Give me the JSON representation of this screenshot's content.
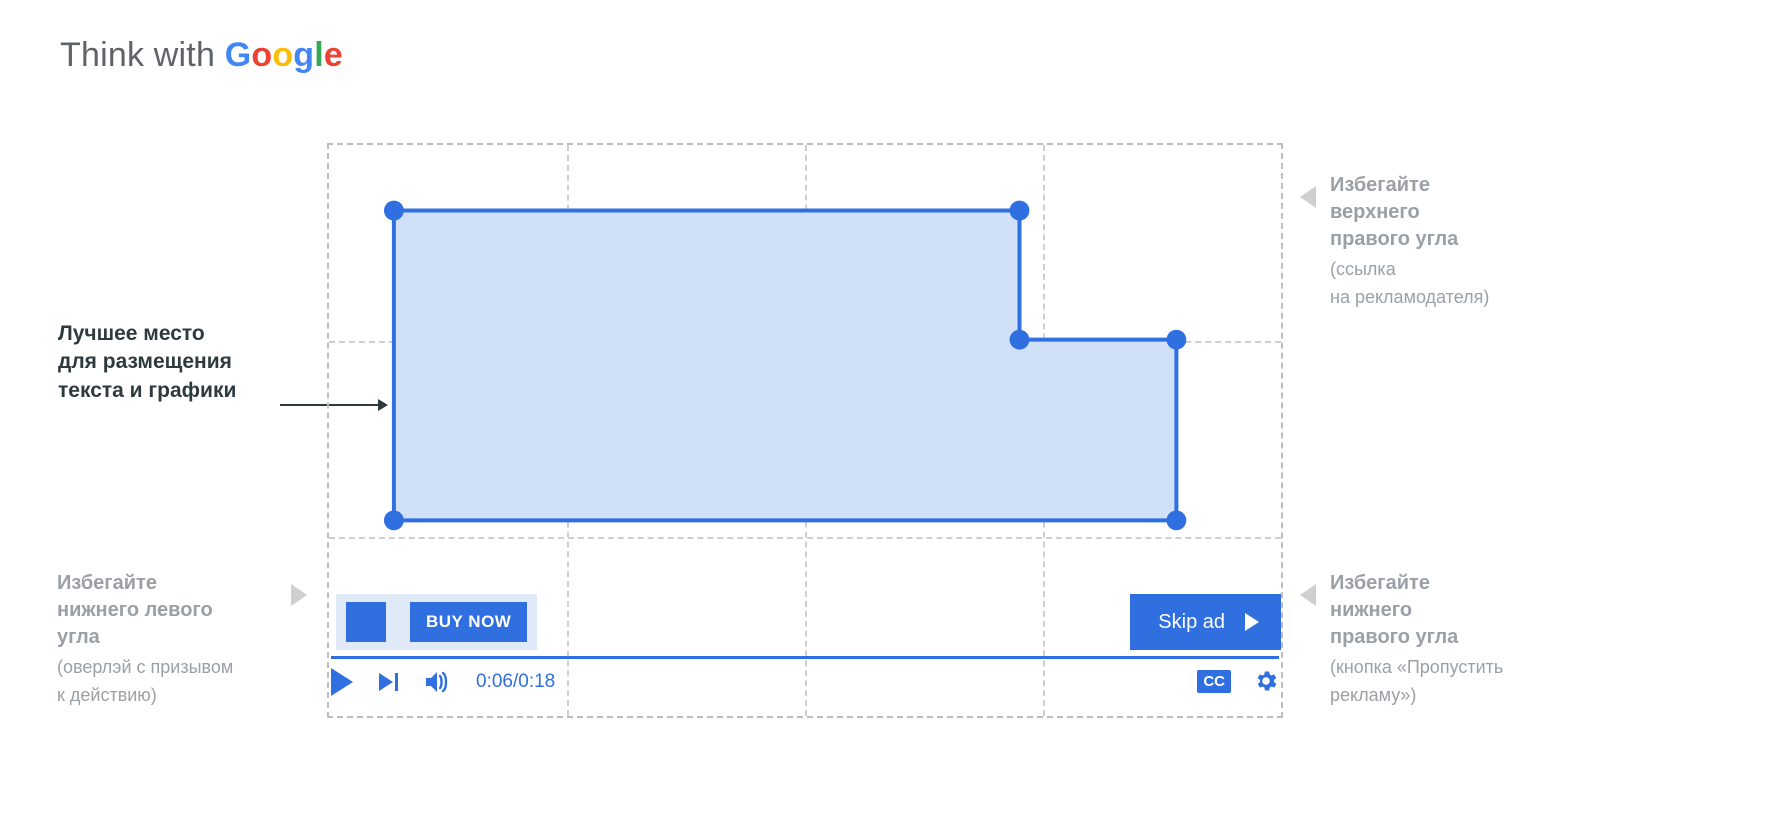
{
  "logo": {
    "prefix": "Think with "
  },
  "annotations": {
    "main": {
      "line1": "Лучшее место",
      "line2": "для размещения",
      "line3": "текста и графики"
    },
    "top_right": {
      "title1": "Избегайте",
      "title2": "верхнего",
      "title3": "правого угла",
      "sub1": "(ссылка",
      "sub2": "на рекламодателя)"
    },
    "bottom_left": {
      "title1": "Избегайте",
      "title2": "нижнего левого",
      "title3": "угла",
      "sub1": "(оверлэй с призывом",
      "sub2": "к действию)"
    },
    "bottom_right": {
      "title1": "Избегайте",
      "title2": "нижнего",
      "title3": "правого угла",
      "sub1": "(кнопка «Пропустить",
      "sub2": "рекламу»)"
    }
  },
  "overlay": {
    "buy_label": "BUY NOW"
  },
  "skip": {
    "label": "Skip ad"
  },
  "player": {
    "time": "0:06/0:18",
    "cc": "CC"
  },
  "colors": {
    "blue": "#2f6fe0",
    "blue_fill": "#cfe0f8",
    "grid": "#cfcfcf",
    "text_muted": "#9aa0a6"
  }
}
